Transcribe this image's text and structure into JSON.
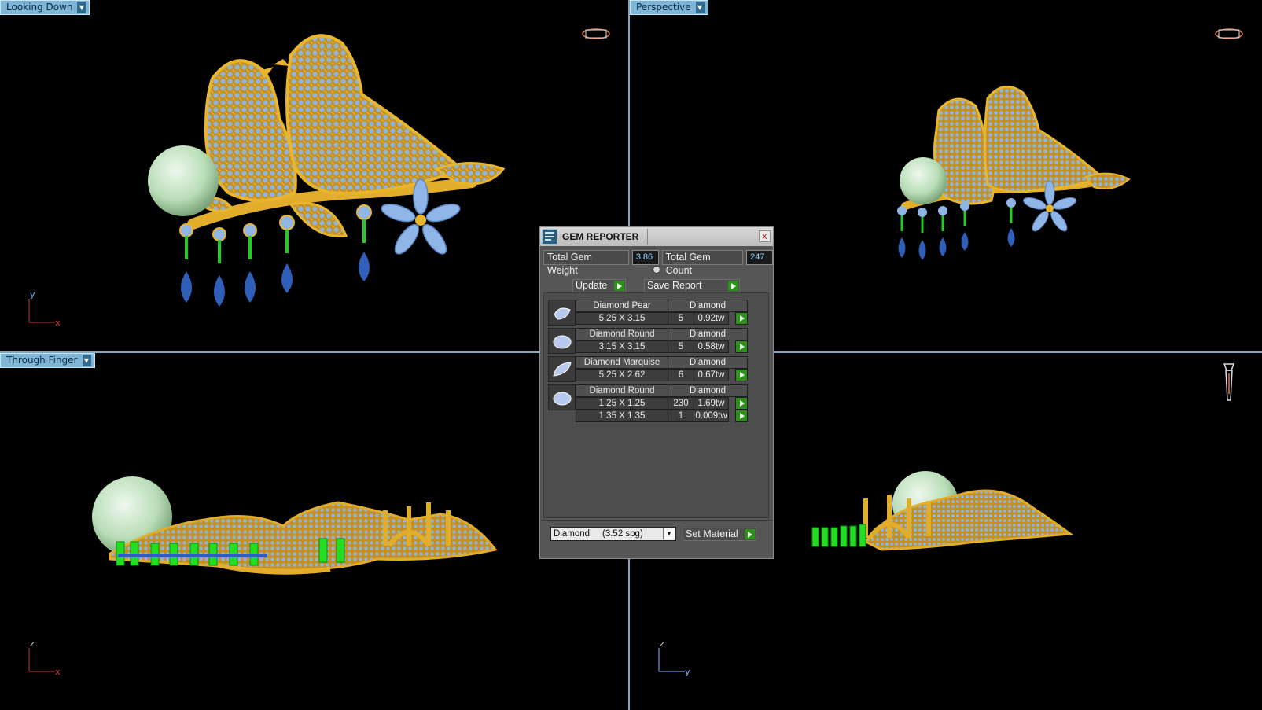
{
  "viewports": {
    "top_left": {
      "label": "Looking Down",
      "axis_v": "y",
      "axis_h": "x"
    },
    "top_right": {
      "label": "Perspective"
    },
    "bottom_left": {
      "label": "Through Finger",
      "axis_v": "z",
      "axis_h": "x"
    },
    "bottom_right": {
      "axis_v": "z",
      "axis_h": "y"
    }
  },
  "gem_reporter": {
    "title": "GEM REPORTER",
    "close_label": "x",
    "total_weight_label": "Total Gem Weight",
    "total_weight_value": "3.86",
    "total_count_label": "Total Gem Count",
    "total_count_value": "247",
    "update_label": "Update",
    "save_label": "Save Report",
    "gems": [
      {
        "name": "Diamond Pear",
        "material": "Diamond",
        "sizes": [
          {
            "dim": "5.25 X 3.15",
            "count": "5",
            "weight": "0.92tw"
          }
        ]
      },
      {
        "name": "Diamond Round",
        "material": "Diamond",
        "sizes": [
          {
            "dim": "3.15 X 3.15",
            "count": "5",
            "weight": "0.58tw"
          }
        ]
      },
      {
        "name": "Diamond Marquise",
        "material": "Diamond",
        "sizes": [
          {
            "dim": "5.25 X 2.62",
            "count": "6",
            "weight": "0.67tw"
          }
        ]
      },
      {
        "name": "Diamond Round",
        "material": "Diamond",
        "sizes": [
          {
            "dim": "1.25 X 1.25",
            "count": "230",
            "weight": "1.69tw"
          },
          {
            "dim": "1.35 X 1.35",
            "count": "1",
            "weight": "0.009tw"
          }
        ]
      }
    ],
    "material_select": "Diamond     (3.52 spg)",
    "set_material_label": "Set Material"
  },
  "colors": {
    "gold": "#d9a520",
    "gem_blue": "#8fb6e6",
    "pearl": "#bde3bd",
    "drop_blue": "#2f5fb8",
    "green_setting": "#22cc22",
    "viewport_label_bg": "#7fb6d6"
  }
}
